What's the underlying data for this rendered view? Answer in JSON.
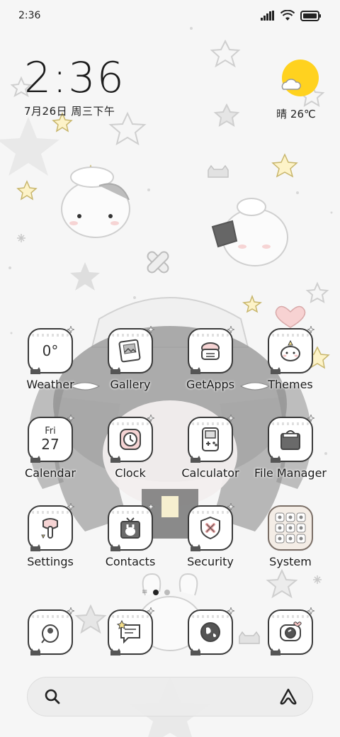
{
  "status_bar": {
    "time": "2:36"
  },
  "clock_widget": {
    "time": "2:36",
    "date": "7月26日 周三下午"
  },
  "weather_widget": {
    "condition": "晴",
    "temperature": "26℃",
    "text": "晴 26℃",
    "icon": "sun-cloud-icon"
  },
  "apps": [
    {
      "label": "Weather",
      "icon": "weather-icon",
      "tile_text": "0°"
    },
    {
      "label": "Gallery",
      "icon": "gallery-icon"
    },
    {
      "label": "GetApps",
      "icon": "getapps-icon"
    },
    {
      "label": "Themes",
      "icon": "themes-icon"
    },
    {
      "label": "Calendar",
      "icon": "calendar-icon",
      "day": "Fri",
      "date": "27"
    },
    {
      "label": "Clock",
      "icon": "clock-icon"
    },
    {
      "label": "Calculator",
      "icon": "calculator-icon"
    },
    {
      "label": "File Manager",
      "icon": "file-manager-icon"
    },
    {
      "label": "Settings",
      "icon": "settings-icon"
    },
    {
      "label": "Contacts",
      "icon": "contacts-icon"
    },
    {
      "label": "Security",
      "icon": "security-icon"
    },
    {
      "label": "System",
      "icon": "system-folder-icon"
    }
  ],
  "dock": [
    {
      "icon": "phone-icon"
    },
    {
      "icon": "messages-icon"
    },
    {
      "icon": "browser-icon"
    },
    {
      "icon": "camera-icon"
    }
  ],
  "page_indicator": {
    "pages": 2,
    "current": 1
  },
  "search_bar": {
    "left_icon": "search-icon",
    "right_icon": "assistant-icon"
  },
  "colors": {
    "sun": "#FFD21F",
    "tile_border": "#3a3a3a",
    "background": "#f6f6f6"
  }
}
